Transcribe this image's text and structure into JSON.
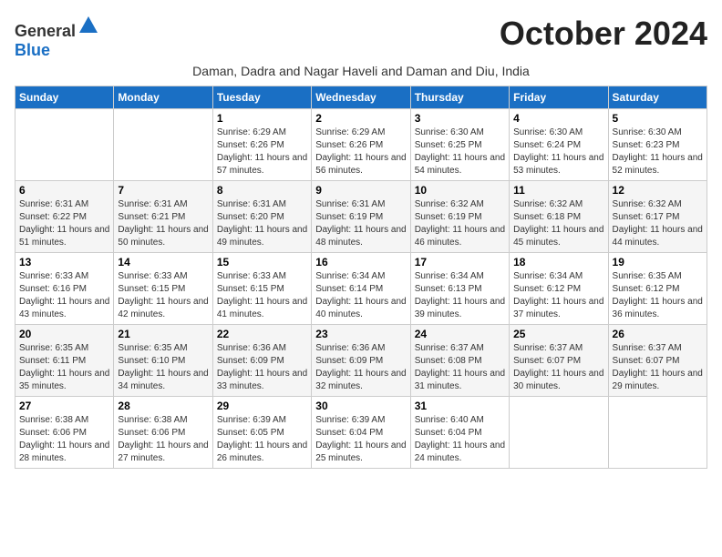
{
  "logo": {
    "text_general": "General",
    "text_blue": "Blue"
  },
  "header": {
    "month_title": "October 2024",
    "subtitle": "Daman, Dadra and Nagar Haveli and Daman and Diu, India"
  },
  "days_of_week": [
    "Sunday",
    "Monday",
    "Tuesday",
    "Wednesday",
    "Thursday",
    "Friday",
    "Saturday"
  ],
  "weeks": [
    [
      {
        "day": "",
        "info": ""
      },
      {
        "day": "",
        "info": ""
      },
      {
        "day": "1",
        "info": "Sunrise: 6:29 AM\nSunset: 6:26 PM\nDaylight: 11 hours and 57 minutes."
      },
      {
        "day": "2",
        "info": "Sunrise: 6:29 AM\nSunset: 6:26 PM\nDaylight: 11 hours and 56 minutes."
      },
      {
        "day": "3",
        "info": "Sunrise: 6:30 AM\nSunset: 6:25 PM\nDaylight: 11 hours and 54 minutes."
      },
      {
        "day": "4",
        "info": "Sunrise: 6:30 AM\nSunset: 6:24 PM\nDaylight: 11 hours and 53 minutes."
      },
      {
        "day": "5",
        "info": "Sunrise: 6:30 AM\nSunset: 6:23 PM\nDaylight: 11 hours and 52 minutes."
      }
    ],
    [
      {
        "day": "6",
        "info": "Sunrise: 6:31 AM\nSunset: 6:22 PM\nDaylight: 11 hours and 51 minutes."
      },
      {
        "day": "7",
        "info": "Sunrise: 6:31 AM\nSunset: 6:21 PM\nDaylight: 11 hours and 50 minutes."
      },
      {
        "day": "8",
        "info": "Sunrise: 6:31 AM\nSunset: 6:20 PM\nDaylight: 11 hours and 49 minutes."
      },
      {
        "day": "9",
        "info": "Sunrise: 6:31 AM\nSunset: 6:19 PM\nDaylight: 11 hours and 48 minutes."
      },
      {
        "day": "10",
        "info": "Sunrise: 6:32 AM\nSunset: 6:19 PM\nDaylight: 11 hours and 46 minutes."
      },
      {
        "day": "11",
        "info": "Sunrise: 6:32 AM\nSunset: 6:18 PM\nDaylight: 11 hours and 45 minutes."
      },
      {
        "day": "12",
        "info": "Sunrise: 6:32 AM\nSunset: 6:17 PM\nDaylight: 11 hours and 44 minutes."
      }
    ],
    [
      {
        "day": "13",
        "info": "Sunrise: 6:33 AM\nSunset: 6:16 PM\nDaylight: 11 hours and 43 minutes."
      },
      {
        "day": "14",
        "info": "Sunrise: 6:33 AM\nSunset: 6:15 PM\nDaylight: 11 hours and 42 minutes."
      },
      {
        "day": "15",
        "info": "Sunrise: 6:33 AM\nSunset: 6:15 PM\nDaylight: 11 hours and 41 minutes."
      },
      {
        "day": "16",
        "info": "Sunrise: 6:34 AM\nSunset: 6:14 PM\nDaylight: 11 hours and 40 minutes."
      },
      {
        "day": "17",
        "info": "Sunrise: 6:34 AM\nSunset: 6:13 PM\nDaylight: 11 hours and 39 minutes."
      },
      {
        "day": "18",
        "info": "Sunrise: 6:34 AM\nSunset: 6:12 PM\nDaylight: 11 hours and 37 minutes."
      },
      {
        "day": "19",
        "info": "Sunrise: 6:35 AM\nSunset: 6:12 PM\nDaylight: 11 hours and 36 minutes."
      }
    ],
    [
      {
        "day": "20",
        "info": "Sunrise: 6:35 AM\nSunset: 6:11 PM\nDaylight: 11 hours and 35 minutes."
      },
      {
        "day": "21",
        "info": "Sunrise: 6:35 AM\nSunset: 6:10 PM\nDaylight: 11 hours and 34 minutes."
      },
      {
        "day": "22",
        "info": "Sunrise: 6:36 AM\nSunset: 6:09 PM\nDaylight: 11 hours and 33 minutes."
      },
      {
        "day": "23",
        "info": "Sunrise: 6:36 AM\nSunset: 6:09 PM\nDaylight: 11 hours and 32 minutes."
      },
      {
        "day": "24",
        "info": "Sunrise: 6:37 AM\nSunset: 6:08 PM\nDaylight: 11 hours and 31 minutes."
      },
      {
        "day": "25",
        "info": "Sunrise: 6:37 AM\nSunset: 6:07 PM\nDaylight: 11 hours and 30 minutes."
      },
      {
        "day": "26",
        "info": "Sunrise: 6:37 AM\nSunset: 6:07 PM\nDaylight: 11 hours and 29 minutes."
      }
    ],
    [
      {
        "day": "27",
        "info": "Sunrise: 6:38 AM\nSunset: 6:06 PM\nDaylight: 11 hours and 28 minutes."
      },
      {
        "day": "28",
        "info": "Sunrise: 6:38 AM\nSunset: 6:06 PM\nDaylight: 11 hours and 27 minutes."
      },
      {
        "day": "29",
        "info": "Sunrise: 6:39 AM\nSunset: 6:05 PM\nDaylight: 11 hours and 26 minutes."
      },
      {
        "day": "30",
        "info": "Sunrise: 6:39 AM\nSunset: 6:04 PM\nDaylight: 11 hours and 25 minutes."
      },
      {
        "day": "31",
        "info": "Sunrise: 6:40 AM\nSunset: 6:04 PM\nDaylight: 11 hours and 24 minutes."
      },
      {
        "day": "",
        "info": ""
      },
      {
        "day": "",
        "info": ""
      }
    ]
  ]
}
